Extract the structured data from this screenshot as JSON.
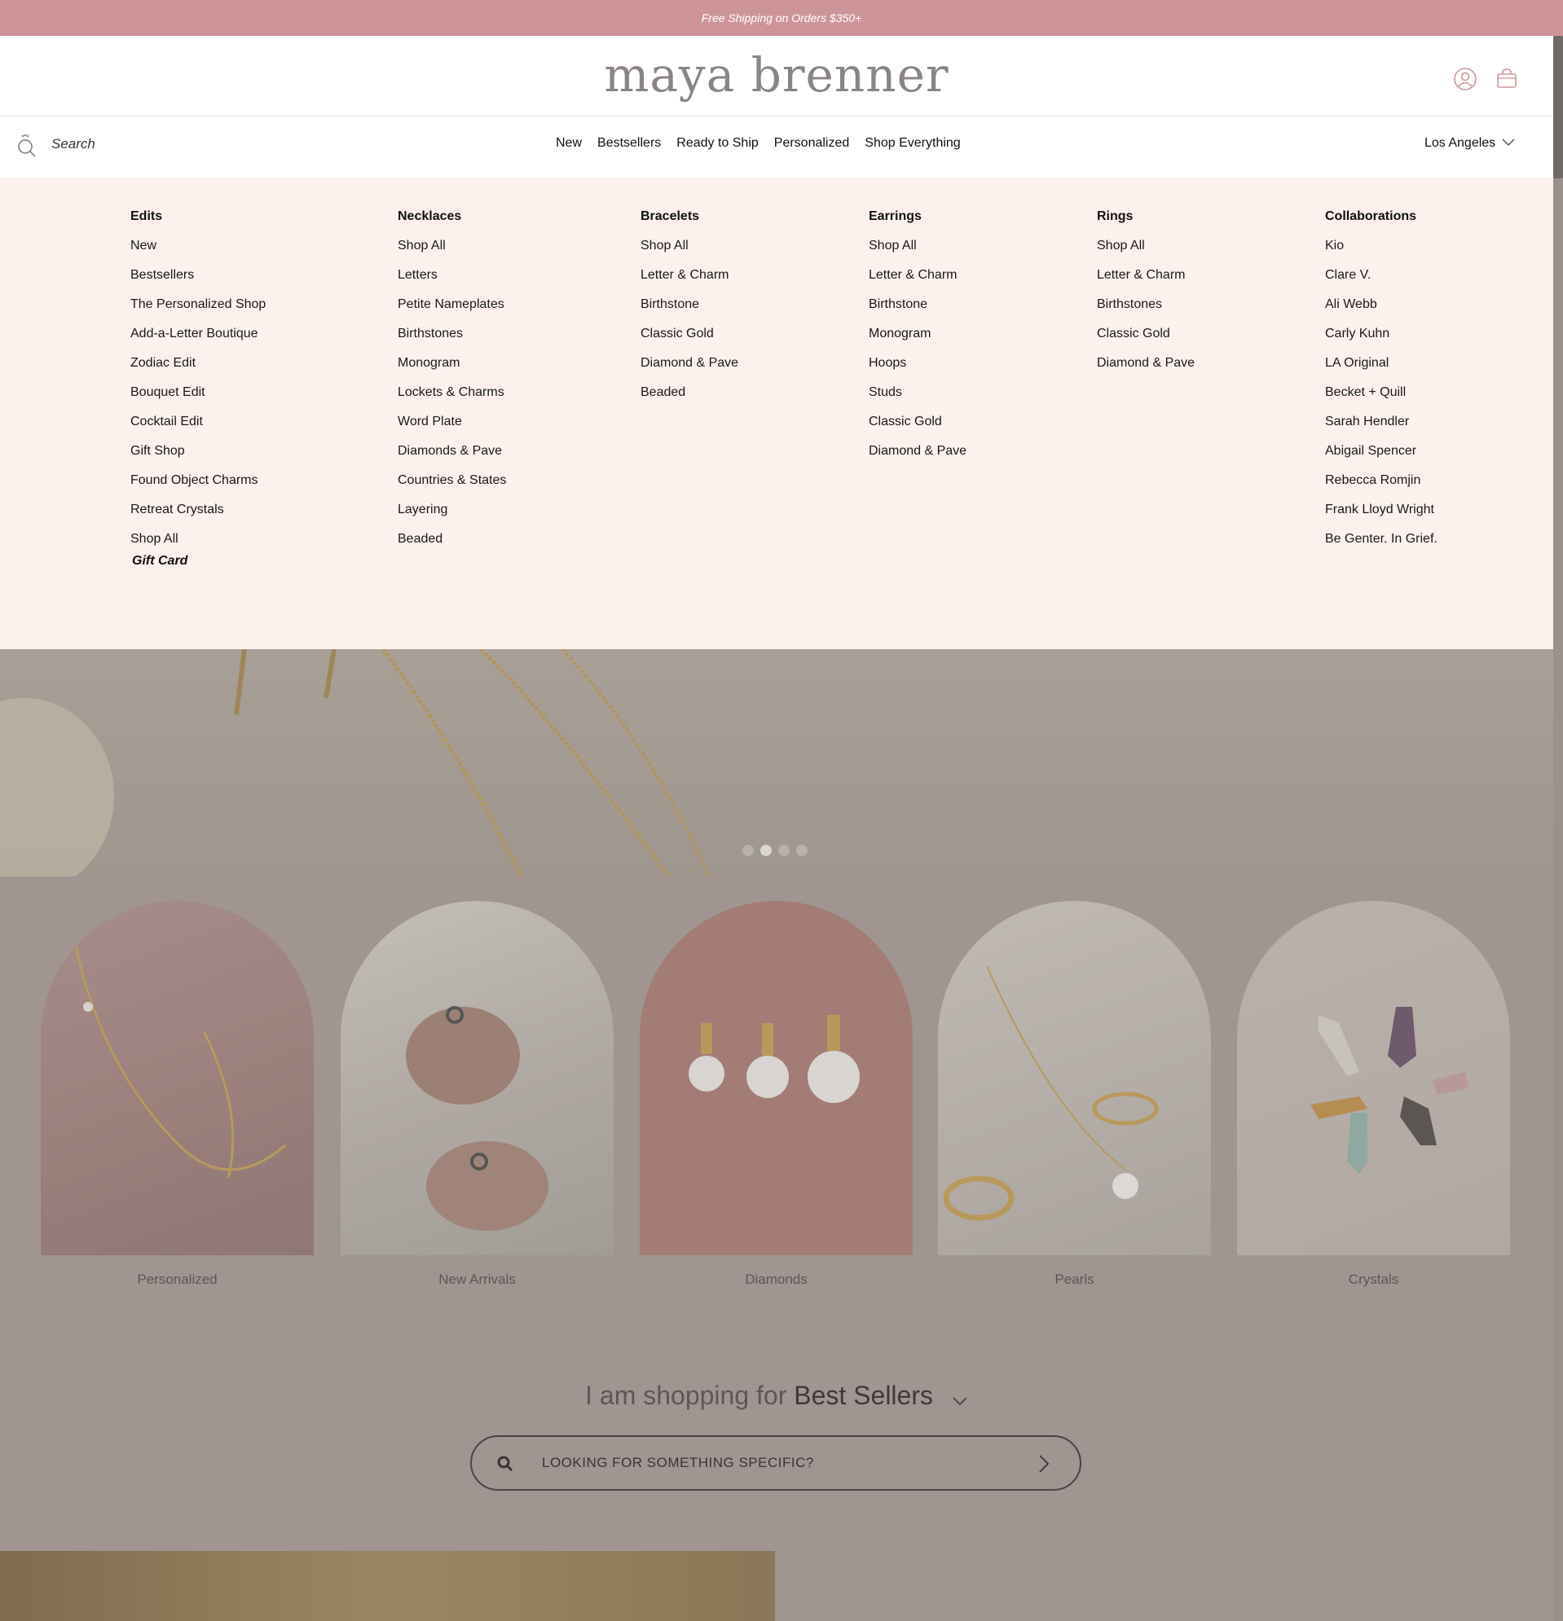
{
  "promo": "Free Shipping on Orders $350+",
  "logo": "maya brenner",
  "search": {
    "placeholder": "Search"
  },
  "nav": [
    "New",
    "Bestsellers",
    "Ready to Ship",
    "Personalized",
    "Shop Everything"
  ],
  "location": "Los Angeles",
  "mega_menu": [
    {
      "title": "Edits",
      "items": [
        "New",
        "Bestsellers",
        "The Personalized Shop",
        "Add-a-Letter Boutique",
        "Zodiac Edit",
        "Bouquet Edit",
        "Cocktail Edit",
        "Gift Shop",
        "Found Object Charms",
        "Retreat Crystals",
        "Shop All"
      ],
      "extra": "Gift Card"
    },
    {
      "title": "Necklaces",
      "items": [
        "Shop All",
        "Letters",
        "Petite Nameplates",
        "Birthstones",
        "Monogram",
        "Lockets & Charms",
        "Word Plate",
        "Diamonds & Pave",
        "Countries & States",
        "Layering",
        "Beaded"
      ]
    },
    {
      "title": "Bracelets",
      "items": [
        "Shop All",
        "Letter & Charm",
        "Birthstone",
        "Classic Gold",
        "Diamond & Pave",
        "Beaded"
      ]
    },
    {
      "title": "Earrings",
      "items": [
        "Shop All",
        "Letter & Charm",
        "Birthstone",
        "Monogram",
        "Hoops",
        "Studs",
        "Classic Gold",
        "Diamond & Pave"
      ]
    },
    {
      "title": "Rings",
      "items": [
        "Shop All",
        "Letter & Charm",
        "Birthstones",
        "Classic Gold",
        "Diamond & Pave"
      ]
    },
    {
      "title": "Collaborations",
      "items": [
        "Kio",
        "Clare V.",
        "Ali Webb",
        "Carly Kuhn",
        "LA Original",
        "Becket + Quill",
        "Sarah Hendler",
        "Abigail Spencer",
        "Rebecca Romjin",
        "Frank Lloyd Wright",
        "Be Genter. In Grief."
      ]
    }
  ],
  "carousel": {
    "slides": 4,
    "active": 2
  },
  "categories": [
    "Personalized",
    "New Arrivals",
    "Diamonds",
    "Pearls",
    "Crystals"
  ],
  "shopping": {
    "prefix": "I am shopping for",
    "value": "Best Sellers"
  },
  "specific_search": "LOOKING FOR SOMETHING SPECIFIC?",
  "colors": {
    "promo_bg": "#cd959a",
    "mega_bg": "#fcf1ed",
    "overlay": "#a09590"
  }
}
